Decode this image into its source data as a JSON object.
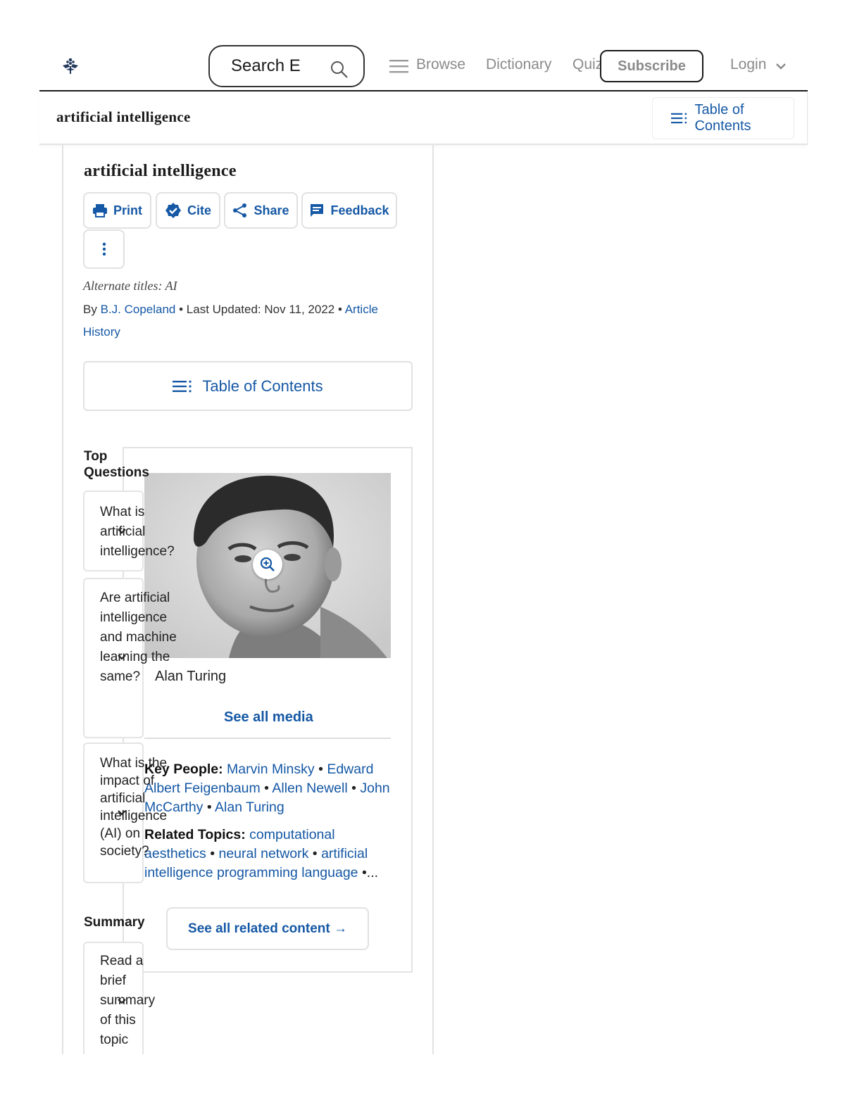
{
  "header": {
    "search_placeholder": "Search E",
    "nav": [
      "Browse",
      "Dictionary",
      "Quiz"
    ],
    "subscribe_label": "Subscribe",
    "login_label": "Login"
  },
  "sticky": {
    "title": "artificial intelligence",
    "toc_label": "Table of Contents"
  },
  "article": {
    "title": "artificial intelligence",
    "tools": [
      "Print",
      "Cite",
      "Share",
      "Feedback"
    ],
    "alternate_titles": "Alternate titles: AI",
    "by_prefix": "By",
    "author": "B.J. Copeland",
    "updated": " • Last Updated: Nov 11, 2022 • ",
    "history_label": "Article History",
    "toc_label": "Table of Contents"
  },
  "top_questions": {
    "heading": "Top Questions",
    "items": [
      "What is artificial intelligence?",
      "Are artificial intelligence and machine learning the same?",
      "What is the impact of artificial intelligence (AI) on society?"
    ]
  },
  "summary": {
    "heading": "Summary",
    "item": "Read a brief summary of this topic"
  },
  "media": {
    "caption": "Alan Turing",
    "see_all": "See all media"
  },
  "facts": {
    "key_people_label": "Key People:",
    "key_people": [
      "Marvin Minsky",
      "Edward Albert Feigenbaum",
      "Allen Newell",
      "John McCarthy",
      "Alan Turing"
    ],
    "related_label": "Related Topics:",
    "related": [
      "computational aesthetics",
      "neural network",
      "artificial intelligence programming language"
    ],
    "ellipsis": "..."
  },
  "related_button": "See all related content →"
}
